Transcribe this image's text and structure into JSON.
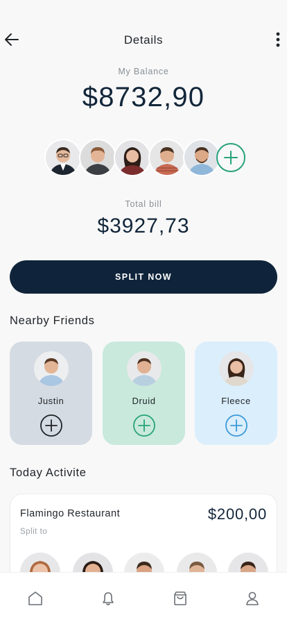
{
  "header": {
    "title": "Details",
    "back_icon": "arrow-left-icon",
    "more_icon": "more-vertical-icon"
  },
  "balance": {
    "label": "My Balance",
    "value": "$8732,90"
  },
  "split_group": {
    "avatar_count": 5,
    "add_icon": "plus-circle-icon"
  },
  "total": {
    "label": "Total bill",
    "value": "$3927,73"
  },
  "split_button": {
    "label": "SPLIT NOW"
  },
  "nearby": {
    "title": "Nearby Friends",
    "friends": [
      {
        "name": "Justin",
        "card_color": "#d5dbe2",
        "accent": "#1f2328"
      },
      {
        "name": "Druid",
        "card_color": "#c8e9dc",
        "accent": "#27a27a"
      },
      {
        "name": "Fleece",
        "card_color": "#dbeefc",
        "accent": "#3a9ad9"
      }
    ]
  },
  "activity": {
    "title": "Today Activite",
    "items": [
      {
        "name": "Flamingo Restaurant",
        "amount": "$200,00",
        "subtitle": "Split to"
      }
    ]
  },
  "bottom_nav": {
    "items": [
      "home-icon",
      "bell-icon",
      "bag-icon",
      "user-icon"
    ]
  },
  "colors": {
    "primary_dark": "#0f243b",
    "accent_green": "#27a27a",
    "accent_blue": "#3a9ad9",
    "background": "#f8f8f8"
  }
}
